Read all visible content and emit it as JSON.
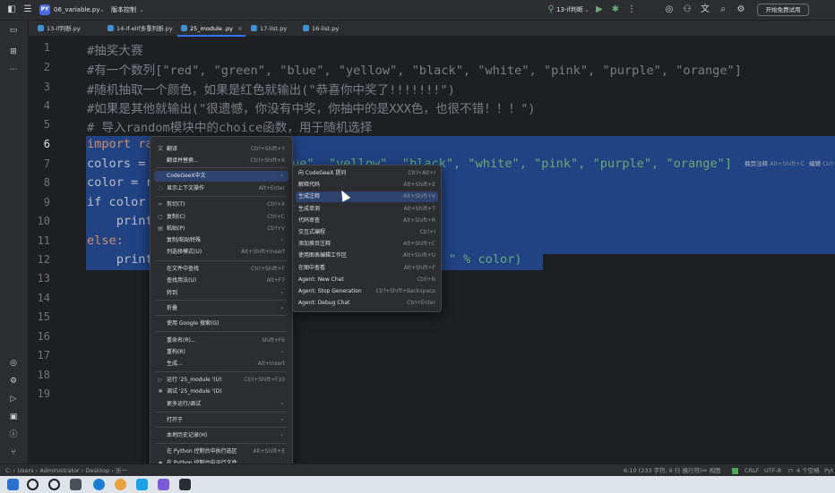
{
  "titlebar": {
    "project": "06_variable.py",
    "project_badge": "PY",
    "vcs": "版本控制",
    "run_config": "13-if判断",
    "trial_button": "开始免费试用"
  },
  "tabs": [
    {
      "label": "13-if判断.py"
    },
    {
      "label": "14-if-elif多重判断.py"
    },
    {
      "label": "25_module .py"
    },
    {
      "label": "17-list.py"
    },
    {
      "label": "16-list.py"
    }
  ],
  "editor": {
    "line_numbers": [
      "1",
      "2",
      "3",
      "4",
      "5",
      "6",
      "7",
      "8",
      "9",
      "10",
      "11",
      "12",
      "13",
      "14",
      "15",
      "16",
      "17",
      "18",
      "19"
    ],
    "current_line": "6",
    "lines": [
      "#抽奖大赛",
      "#有一个数列[\"red\", \"green\", \"blue\", \"yellow\", \"black\", \"white\", \"pink\", \"purple\", \"orange\"]",
      "#随机抽取一个颜色，如果是红色就输出(\"恭喜你中奖了!!!!!!!\")",
      "#如果是其他就输出(\"很遗憾，你没有中奖，你抽中的是XXX色，也很不错！！！\")",
      "# 导入random模块中的choice函数，用于随机选择",
      "import ra",
      "colors = ",
      "color = r",
      "if color ",
      "    print",
      "else:",
      "    print"
    ],
    "line7_tail": "ue\", \"yellow\", \"black\", \"white\", \"pink\", \"purple\", \"orange\"]",
    "line12_tail": "! ! \" % color)",
    "hint_right": [
      {
        "label": "换页注释",
        "key": "Alt+Shift+C"
      },
      {
        "label": "编辑",
        "key": "Ctrl+S"
      }
    ]
  },
  "context_menu": {
    "items": [
      {
        "icon": "文",
        "label": "翻译",
        "shortcut": "Ctrl+Shift+Y"
      },
      {
        "icon": "",
        "label": "翻译并替换...",
        "shortcut": "Ctrl+Shift+X"
      },
      {
        "icon": "",
        "label": "CodeGeeX中文",
        "shortcut": "",
        "submenu": true
      },
      {
        "icon": "◌",
        "label": "显示上下文操作",
        "shortcut": "Alt+Enter"
      },
      {
        "icon": "✂",
        "label": "剪切(T)",
        "shortcut": "Ctrl+X"
      },
      {
        "icon": "▢",
        "label": "复制(C)",
        "shortcut": "Ctrl+C"
      },
      {
        "icon": "▤",
        "label": "粘贴(P)",
        "shortcut": "Ctrl+V"
      },
      {
        "icon": "",
        "label": "复制/粘贴特殊",
        "shortcut": "",
        "submenu": true
      },
      {
        "icon": "",
        "label": "列选择模式(U)",
        "shortcut": "Alt+Shift+Insert"
      },
      {
        "icon": "",
        "label": "在文件中查找",
        "shortcut": "Ctrl+Shift+F"
      },
      {
        "icon": "",
        "label": "查找用法(U)",
        "shortcut": "Alt+F7"
      },
      {
        "icon": "",
        "label": "转到",
        "shortcut": "",
        "submenu": true
      },
      {
        "icon": "",
        "label": "折叠",
        "shortcut": "",
        "submenu": true
      },
      {
        "icon": "",
        "label": "使用 Google 搜索(G)",
        "shortcut": ""
      },
      {
        "icon": "",
        "label": "重命名(R)...",
        "shortcut": "Shift+F6"
      },
      {
        "icon": "",
        "label": "重构(R)",
        "shortcut": "",
        "submenu": true
      },
      {
        "icon": "",
        "label": "生成...",
        "shortcut": "Alt+Insert"
      },
      {
        "icon": "▷",
        "label": "运行 '25_module '(U)",
        "shortcut": "Ctrl+Shift+F10"
      },
      {
        "icon": "✱",
        "label": "调试 '25_module '(D)",
        "shortcut": ""
      },
      {
        "icon": "",
        "label": "更多运行/调试",
        "shortcut": "",
        "submenu": true
      },
      {
        "icon": "",
        "label": "打开于",
        "shortcut": "",
        "submenu": true
      },
      {
        "icon": "",
        "label": "本地历史记录(H)",
        "shortcut": "",
        "submenu": true
      },
      {
        "icon": "",
        "label": "在 Python 控制台中执行选区",
        "shortcut": "Alt+Shift+E"
      },
      {
        "icon": "◆",
        "label": "在 Python 控制台中运行文件",
        "shortcut": ""
      },
      {
        "icon": "▣",
        "label": "与剪贴板比较(B)",
        "shortcut": ""
      },
      {
        "icon": "▤",
        "label": "图表",
        "shortcut": "",
        "submenu": true
      }
    ]
  },
  "submenu": {
    "items": [
      {
        "label": "向 CodeGeeX 提问",
        "shortcut": "Ctrl+Alt+I"
      },
      {
        "label": "解释代码",
        "shortcut": "Alt+Shift+E"
      },
      {
        "label": "生成注释",
        "shortcut": "Alt+Shift+V"
      },
      {
        "label": "生成单测",
        "shortcut": "Alt+Shift+T"
      },
      {
        "label": "代码审查",
        "shortcut": "Alt+Shift+R"
      },
      {
        "label": "交互式编程",
        "shortcut": "Ctrl+I"
      },
      {
        "label": "添加换页注释",
        "shortcut": "Alt+Shift+C"
      },
      {
        "label": "使用图表编辑工作区",
        "shortcut": "Alt+Shift+U"
      },
      {
        "label": "在图中查看",
        "shortcut": "Alt+Shift+F"
      },
      {
        "label": "Agent: New Chat",
        "shortcut": "Ctrl+N"
      },
      {
        "label": "Agent: Stop Generation",
        "shortcut": "Ctrl+Shift+Backspace"
      },
      {
        "label": "Agent: Debug Chat",
        "shortcut": "Ctrl+Enter"
      }
    ]
  },
  "statusbar": {
    "path": [
      "C:",
      "Users",
      "Administrator",
      "Desktop",
      "乐一"
    ],
    "position": "6:10 (233 字符, 6 行 换行符)",
    "pos_label": "视图",
    "line_sep": "CRLF",
    "encoding": "UTF-8",
    "indent": "4 个空格",
    "interpreter": "Pyt"
  },
  "colors": {
    "selection": "#214283",
    "menu_highlight": "#2e436e",
    "accent": "#3574f0"
  }
}
